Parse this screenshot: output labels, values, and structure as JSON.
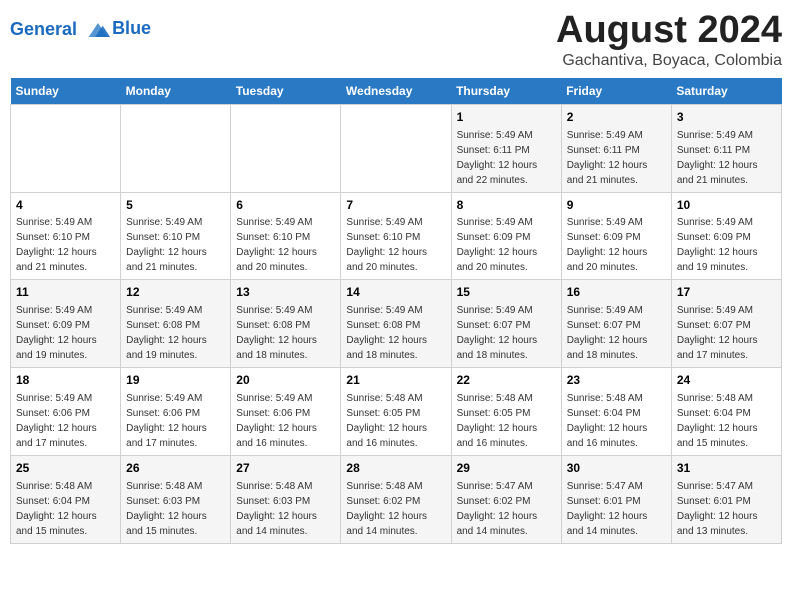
{
  "logo": {
    "line1": "General",
    "line2": "Blue"
  },
  "title": "August 2024",
  "subtitle": "Gachantiva, Boyaca, Colombia",
  "days_of_week": [
    "Sunday",
    "Monday",
    "Tuesday",
    "Wednesday",
    "Thursday",
    "Friday",
    "Saturday"
  ],
  "weeks": [
    [
      {
        "day": "",
        "info": ""
      },
      {
        "day": "",
        "info": ""
      },
      {
        "day": "",
        "info": ""
      },
      {
        "day": "",
        "info": ""
      },
      {
        "day": "1",
        "info": "Sunrise: 5:49 AM\nSunset: 6:11 PM\nDaylight: 12 hours and 22 minutes."
      },
      {
        "day": "2",
        "info": "Sunrise: 5:49 AM\nSunset: 6:11 PM\nDaylight: 12 hours and 21 minutes."
      },
      {
        "day": "3",
        "info": "Sunrise: 5:49 AM\nSunset: 6:11 PM\nDaylight: 12 hours and 21 minutes."
      }
    ],
    [
      {
        "day": "4",
        "info": "Sunrise: 5:49 AM\nSunset: 6:10 PM\nDaylight: 12 hours and 21 minutes."
      },
      {
        "day": "5",
        "info": "Sunrise: 5:49 AM\nSunset: 6:10 PM\nDaylight: 12 hours and 21 minutes."
      },
      {
        "day": "6",
        "info": "Sunrise: 5:49 AM\nSunset: 6:10 PM\nDaylight: 12 hours and 20 minutes."
      },
      {
        "day": "7",
        "info": "Sunrise: 5:49 AM\nSunset: 6:10 PM\nDaylight: 12 hours and 20 minutes."
      },
      {
        "day": "8",
        "info": "Sunrise: 5:49 AM\nSunset: 6:09 PM\nDaylight: 12 hours and 20 minutes."
      },
      {
        "day": "9",
        "info": "Sunrise: 5:49 AM\nSunset: 6:09 PM\nDaylight: 12 hours and 20 minutes."
      },
      {
        "day": "10",
        "info": "Sunrise: 5:49 AM\nSunset: 6:09 PM\nDaylight: 12 hours and 19 minutes."
      }
    ],
    [
      {
        "day": "11",
        "info": "Sunrise: 5:49 AM\nSunset: 6:09 PM\nDaylight: 12 hours and 19 minutes."
      },
      {
        "day": "12",
        "info": "Sunrise: 5:49 AM\nSunset: 6:08 PM\nDaylight: 12 hours and 19 minutes."
      },
      {
        "day": "13",
        "info": "Sunrise: 5:49 AM\nSunset: 6:08 PM\nDaylight: 12 hours and 18 minutes."
      },
      {
        "day": "14",
        "info": "Sunrise: 5:49 AM\nSunset: 6:08 PM\nDaylight: 12 hours and 18 minutes."
      },
      {
        "day": "15",
        "info": "Sunrise: 5:49 AM\nSunset: 6:07 PM\nDaylight: 12 hours and 18 minutes."
      },
      {
        "day": "16",
        "info": "Sunrise: 5:49 AM\nSunset: 6:07 PM\nDaylight: 12 hours and 18 minutes."
      },
      {
        "day": "17",
        "info": "Sunrise: 5:49 AM\nSunset: 6:07 PM\nDaylight: 12 hours and 17 minutes."
      }
    ],
    [
      {
        "day": "18",
        "info": "Sunrise: 5:49 AM\nSunset: 6:06 PM\nDaylight: 12 hours and 17 minutes."
      },
      {
        "day": "19",
        "info": "Sunrise: 5:49 AM\nSunset: 6:06 PM\nDaylight: 12 hours and 17 minutes."
      },
      {
        "day": "20",
        "info": "Sunrise: 5:49 AM\nSunset: 6:06 PM\nDaylight: 12 hours and 16 minutes."
      },
      {
        "day": "21",
        "info": "Sunrise: 5:48 AM\nSunset: 6:05 PM\nDaylight: 12 hours and 16 minutes."
      },
      {
        "day": "22",
        "info": "Sunrise: 5:48 AM\nSunset: 6:05 PM\nDaylight: 12 hours and 16 minutes."
      },
      {
        "day": "23",
        "info": "Sunrise: 5:48 AM\nSunset: 6:04 PM\nDaylight: 12 hours and 16 minutes."
      },
      {
        "day": "24",
        "info": "Sunrise: 5:48 AM\nSunset: 6:04 PM\nDaylight: 12 hours and 15 minutes."
      }
    ],
    [
      {
        "day": "25",
        "info": "Sunrise: 5:48 AM\nSunset: 6:04 PM\nDaylight: 12 hours and 15 minutes."
      },
      {
        "day": "26",
        "info": "Sunrise: 5:48 AM\nSunset: 6:03 PM\nDaylight: 12 hours and 15 minutes."
      },
      {
        "day": "27",
        "info": "Sunrise: 5:48 AM\nSunset: 6:03 PM\nDaylight: 12 hours and 14 minutes."
      },
      {
        "day": "28",
        "info": "Sunrise: 5:48 AM\nSunset: 6:02 PM\nDaylight: 12 hours and 14 minutes."
      },
      {
        "day": "29",
        "info": "Sunrise: 5:47 AM\nSunset: 6:02 PM\nDaylight: 12 hours and 14 minutes."
      },
      {
        "day": "30",
        "info": "Sunrise: 5:47 AM\nSunset: 6:01 PM\nDaylight: 12 hours and 14 minutes."
      },
      {
        "day": "31",
        "info": "Sunrise: 5:47 AM\nSunset: 6:01 PM\nDaylight: 12 hours and 13 minutes."
      }
    ]
  ]
}
